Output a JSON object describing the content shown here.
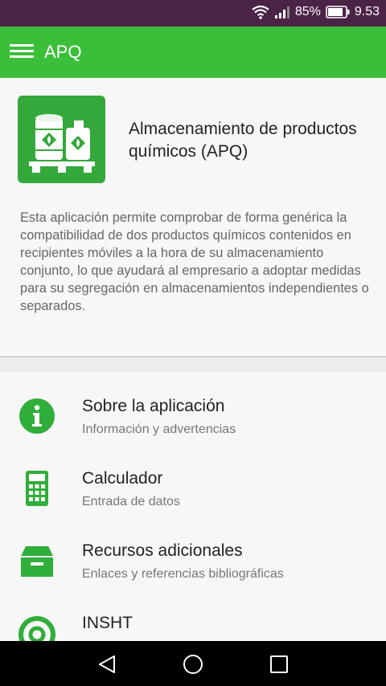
{
  "status_bar": {
    "battery_percent": "85%",
    "time": "9.53",
    "icons": [
      "wifi-icon",
      "signal-icon",
      "battery-icon"
    ]
  },
  "app_bar": {
    "title": "APQ",
    "menu_icon": "menu-icon",
    "color": "#3bbf3a"
  },
  "header_card": {
    "app_icon": "chemical-storage-icon",
    "name": "Almacenamiento de productos químicos (APQ)",
    "description": "Esta aplicación permite comprobar de forma genérica la compatibilidad de dos productos químicos contenidos en recipientes móviles a la hora de su almacenamiento conjunto, lo que ayudará al empresario a adoptar medidas para su segregación en almacenamientos independientes o separados."
  },
  "menu": {
    "items": [
      {
        "icon": "info-icon",
        "title": "Sobre la aplicación",
        "subtitle": "Información y advertencias"
      },
      {
        "icon": "calculator-icon",
        "title": "Calculador",
        "subtitle": "Entrada de datos"
      },
      {
        "icon": "archive-box-icon",
        "title": "Recursos adicionales",
        "subtitle": "Enlaces y referencias bibliográficas"
      },
      {
        "icon": "insht-logo-icon",
        "title": "INSHT",
        "subtitle": ""
      }
    ]
  },
  "nav_bar": {
    "buttons": [
      "back-icon",
      "home-icon",
      "recents-icon"
    ]
  },
  "colors": {
    "accent": "#3bbf3a",
    "icon_green": "#2fae3a",
    "status_bar": "#4a2346"
  }
}
